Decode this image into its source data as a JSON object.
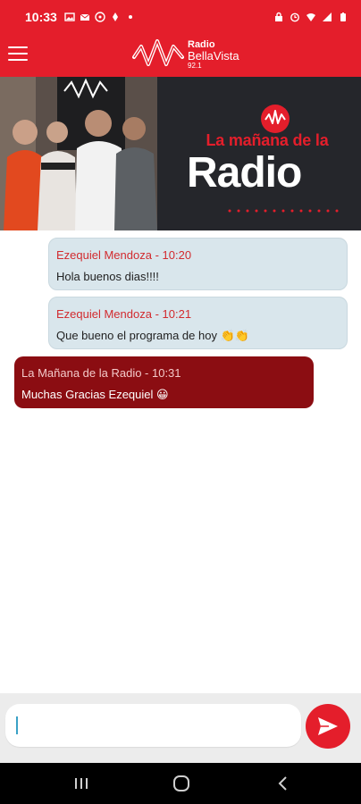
{
  "status_bar": {
    "time": "10:33"
  },
  "app": {
    "logo_line1": "Radio",
    "logo_line2": "BellaVista",
    "logo_line3": "92.1"
  },
  "banner": {
    "title_small": "La mañana de la",
    "title_big": "Radio"
  },
  "messages": [
    {
      "sender": "Ezequiel Mendoza - 10:20",
      "text": "Hola buenos dias!!!!",
      "type": "incoming"
    },
    {
      "sender": "Ezequiel Mendoza - 10:21",
      "text": "Que bueno el programa de hoy 👏👏",
      "type": "incoming"
    },
    {
      "sender": "La Mañana de la Radio  - 10:31",
      "text": "Muchas Gracias Ezequiel 😀",
      "type": "outgoing"
    }
  ],
  "composer": {
    "placeholder": ""
  },
  "icons": {
    "menu": "hamburger-icon",
    "send": "send-icon",
    "nav_recents": "recents-icon",
    "nav_home": "home-icon",
    "nav_back": "back-icon"
  },
  "colors": {
    "brand_red": "#e41e2b",
    "incoming_bubble": "#d9e6ec",
    "outgoing_bubble": "#8b0d12"
  }
}
